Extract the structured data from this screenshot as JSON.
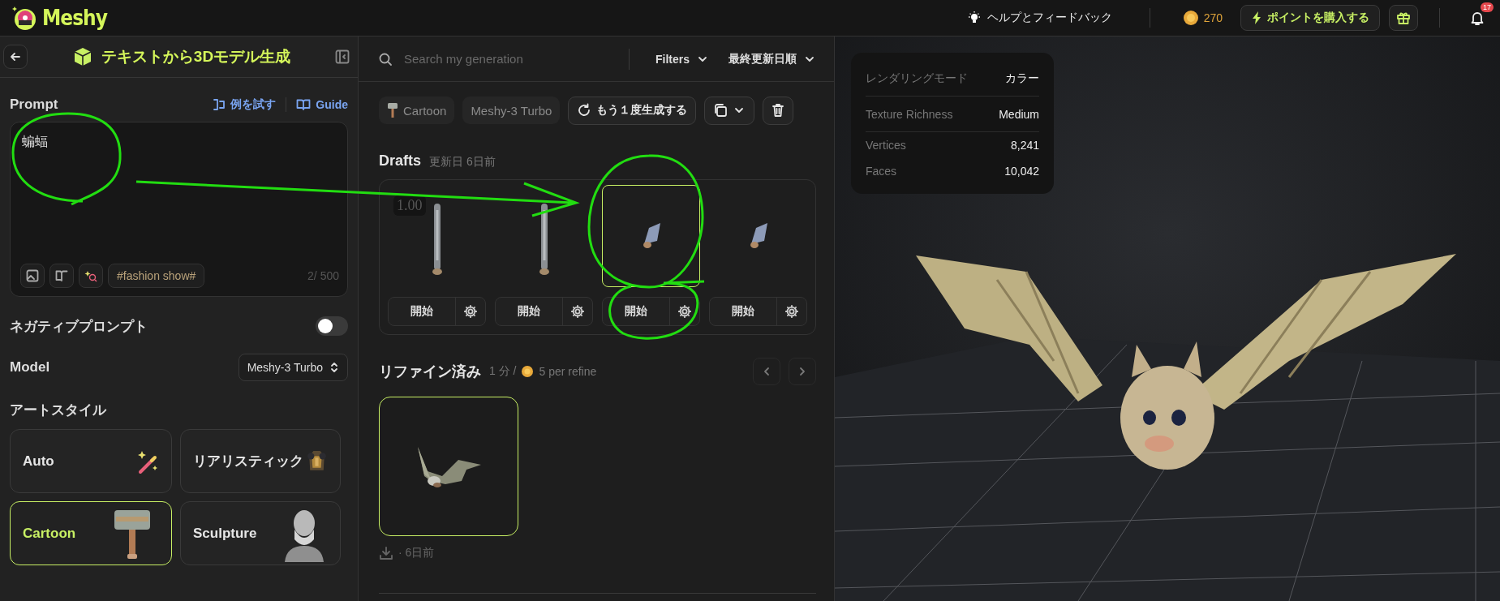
{
  "app": {
    "name": "Meshy"
  },
  "topbar": {
    "help": "ヘルプとフィードバック",
    "credits": "270",
    "buy": "ポイントを購入する",
    "notifications": "17"
  },
  "left": {
    "title": "テキストから3Dモデル生成",
    "prompt_label": "Prompt",
    "try_example": "例を試す",
    "guide": "Guide",
    "prompt_value": "蝙蝠",
    "suggestion": "#fashion show#",
    "count": "2/ 500",
    "negative": {
      "label": "ネガティブプロンプト",
      "on": false
    },
    "model": {
      "label": "Model",
      "value": "Meshy-3 Turbo"
    },
    "art_style": {
      "label": "アートスタイル",
      "options": [
        {
          "label": "Auto",
          "kind": "wand",
          "selected": false
        },
        {
          "label": "リアリスティック",
          "kind": "armor",
          "selected": false
        },
        {
          "label": "Cartoon",
          "kind": "hammer",
          "selected": true
        },
        {
          "label": "Sculpture",
          "kind": "bust",
          "selected": false
        }
      ]
    }
  },
  "middle": {
    "search": {
      "placeholder": "Search my generation"
    },
    "filters": "Filters",
    "sort": "最終更新日順",
    "tags": [
      {
        "label": "Cartoon",
        "kind": "hammer"
      },
      {
        "label": "Meshy-3 Turbo",
        "kind": "text"
      }
    ],
    "regenerate": "もう１度生成する",
    "drafts": {
      "title": "Drafts",
      "updated": "更新日 6日前",
      "items": [
        {
          "kind": "baseball-bat",
          "badge": "1.00",
          "selected": false,
          "start": "開始"
        },
        {
          "kind": "baseball-bat",
          "selected": false,
          "start": "開始"
        },
        {
          "kind": "bat",
          "selected": true,
          "start": "開始"
        },
        {
          "kind": "bat",
          "selected": false,
          "start": "開始"
        }
      ]
    },
    "refined": {
      "title": "リファイン済み",
      "time": "1 分 /",
      "cost": "5 per refine",
      "items": [
        {
          "kind": "bat",
          "selected": true,
          "date": "· 6日前"
        }
      ]
    }
  },
  "viewer": {
    "stats": [
      {
        "label": "レンダリングモード",
        "value": "カラー"
      },
      {
        "label": "Texture Richness",
        "value": "Medium"
      },
      {
        "label": "Vertices",
        "value": "8,241"
      },
      {
        "label": "Faces",
        "value": "10,042"
      }
    ]
  }
}
